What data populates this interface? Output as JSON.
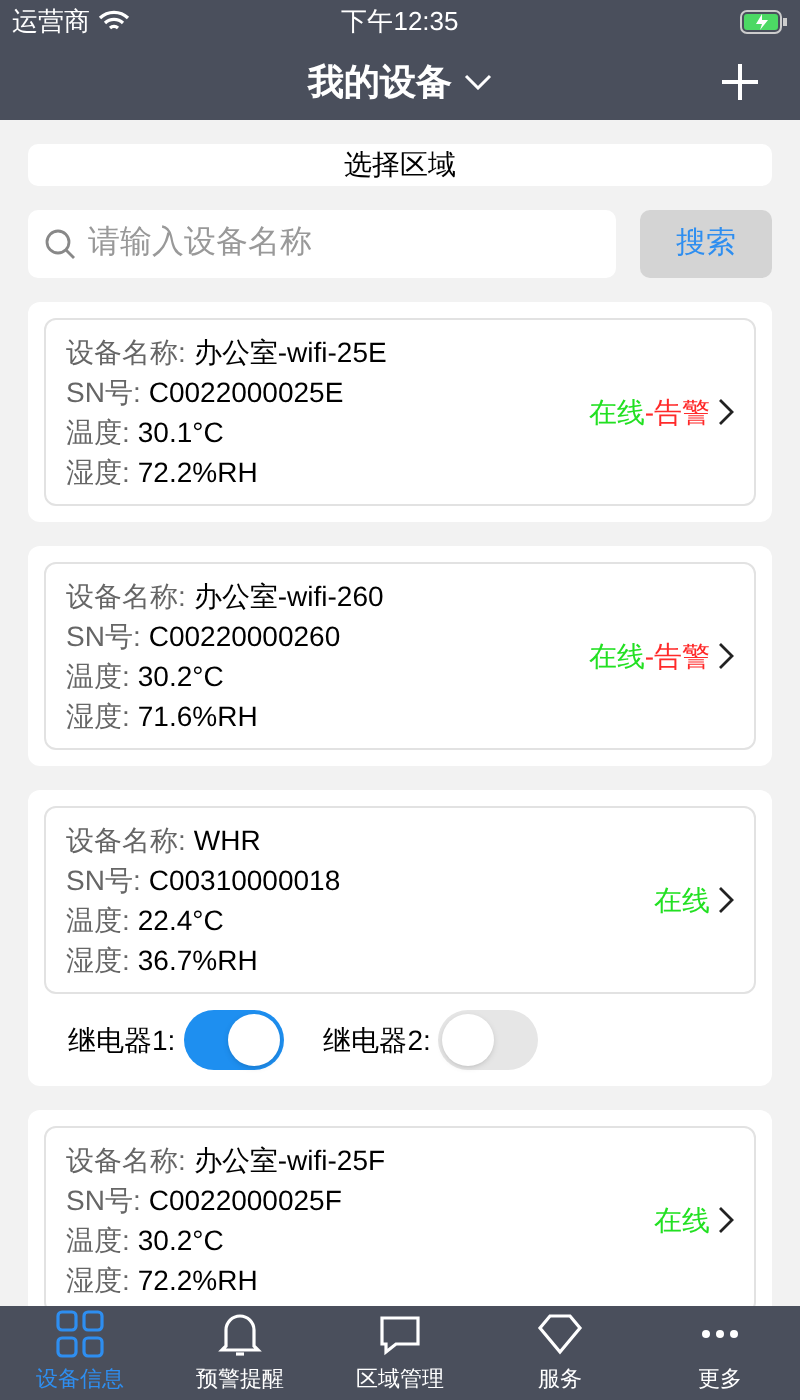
{
  "status_bar": {
    "carrier": "运营商",
    "time": "下午12:35"
  },
  "header": {
    "title": "我的设备"
  },
  "region_button": "选择区域",
  "search": {
    "placeholder": "请输入设备名称",
    "button": "搜索"
  },
  "devices": [
    {
      "fields": [
        {
          "label": "设备名称:",
          "value": "办公室-wifi-25E"
        },
        {
          "label": "SN号:",
          "value": "C0022000025E"
        },
        {
          "label": "温度:",
          "value": "30.1°C"
        },
        {
          "label": "湿度:",
          "value": "72.2%RH"
        }
      ],
      "online": "在线",
      "alarm": "-告警"
    },
    {
      "fields": [
        {
          "label": "设备名称:",
          "value": "办公室-wifi-260"
        },
        {
          "label": "SN号:",
          "value": "C00220000260"
        },
        {
          "label": "温度:",
          "value": "30.2°C"
        },
        {
          "label": "湿度:",
          "value": "71.6%RH"
        }
      ],
      "online": "在线",
      "alarm": "-告警"
    },
    {
      "fields": [
        {
          "label": "设备名称:",
          "value": "WHR"
        },
        {
          "label": "SN号:",
          "value": "C00310000018"
        },
        {
          "label": "温度:",
          "value": "22.4°C"
        },
        {
          "label": "湿度:",
          "value": "36.7%RH"
        }
      ],
      "online": "在线",
      "relays": [
        {
          "label": "继电器1:",
          "on": true
        },
        {
          "label": "继电器2:",
          "on": false
        }
      ]
    },
    {
      "fields": [
        {
          "label": "设备名称:",
          "value": "办公室-wifi-25F"
        },
        {
          "label": "SN号:",
          "value": "C0022000025F"
        },
        {
          "label": "温度:",
          "value": "30.2°C"
        },
        {
          "label": "湿度:",
          "value": "72.2%RH"
        }
      ],
      "online": "在线"
    }
  ],
  "tabs": [
    {
      "label": "设备信息",
      "kind": "grid",
      "selected": true
    },
    {
      "label": "预警提醒",
      "kind": "bell",
      "selected": false
    },
    {
      "label": "区域管理",
      "kind": "chat",
      "selected": false
    },
    {
      "label": "服务",
      "kind": "diamond",
      "selected": false
    },
    {
      "label": "更多",
      "kind": "more",
      "selected": false
    }
  ]
}
